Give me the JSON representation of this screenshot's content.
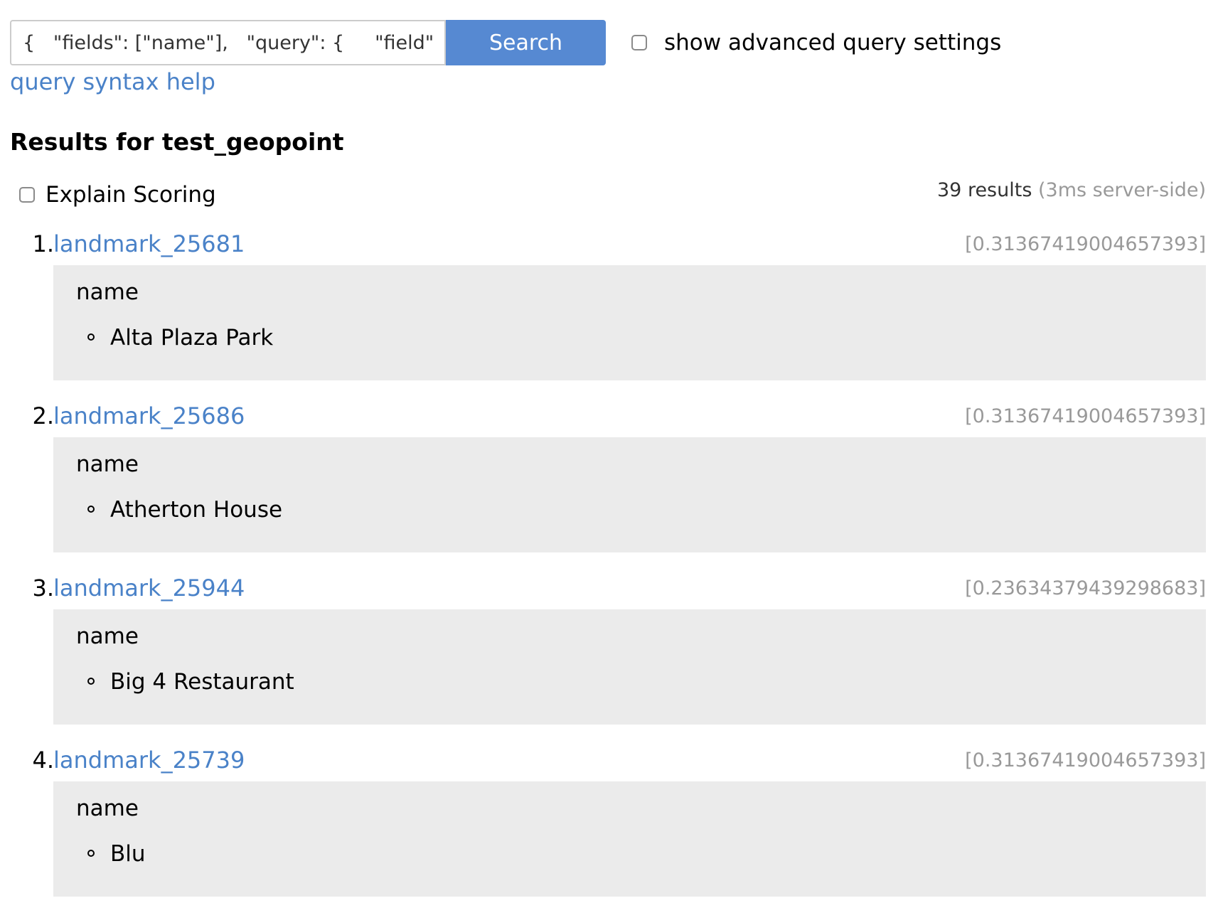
{
  "search": {
    "query_value": "{   \"fields\": [\"name\"],   \"query\": {     \"field\": \"ge",
    "button_label": "Search",
    "advanced_label": "show advanced query settings",
    "help_link": "query syntax help"
  },
  "results": {
    "title": "Results for test_geopoint",
    "explain_label": "Explain Scoring",
    "count": "39 results",
    "server_time": "(3ms server-side)",
    "items": [
      {
        "number": "1.",
        "id": "landmark_25681",
        "score": "[0.31367419004657393]",
        "field": "name",
        "value": "Alta Plaza Park"
      },
      {
        "number": "2.",
        "id": "landmark_25686",
        "score": "[0.31367419004657393]",
        "field": "name",
        "value": "Atherton House"
      },
      {
        "number": "3.",
        "id": "landmark_25944",
        "score": "[0.23634379439298683]",
        "field": "name",
        "value": "Big 4 Restaurant"
      },
      {
        "number": "4.",
        "id": "landmark_25739",
        "score": "[0.31367419004657393]",
        "field": "name",
        "value": "Blu"
      }
    ]
  },
  "colors": {
    "link": "#4a82c8",
    "button": "#5689d2",
    "result_box": "#ebebeb",
    "muted": "#999999"
  }
}
